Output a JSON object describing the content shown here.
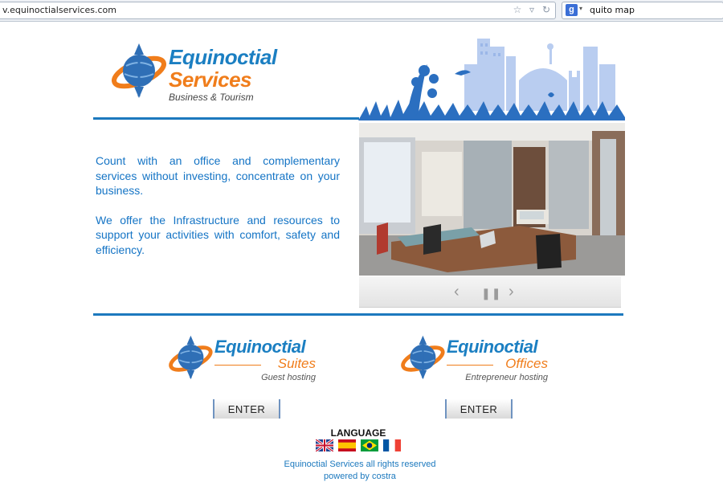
{
  "browser": {
    "url": "v.equinoctialservices.com",
    "search_engine_icon": "google-icon",
    "search_query": "quito map"
  },
  "header": {
    "logo_line1": "Equinoctial",
    "logo_line2": "Services",
    "logo_tagline": "Business & Tourism"
  },
  "intro": {
    "paragraph1": "Count with an office and complementary services without investing, concentrate on your business.",
    "paragraph2": "We offer the Infrastructure and resources to support your activities with comfort, safety and efficiency."
  },
  "slider": {
    "prev_icon": "chevron-left-icon",
    "pause_icon": "pause-icon",
    "next_icon": "chevron-right-icon"
  },
  "brands": [
    {
      "title": "Equinoctial",
      "subtitle": "Suites",
      "tagline": "Guest hosting",
      "button_label": "ENTER"
    },
    {
      "title": "Equinoctial",
      "subtitle": "Offices",
      "tagline": "Entrepreneur hosting",
      "button_label": "ENTER"
    }
  ],
  "language": {
    "title": "LANGUAGE",
    "flags": [
      "flag-uk-icon",
      "flag-spain-icon",
      "flag-brazil-icon",
      "flag-france-icon"
    ]
  },
  "footer": {
    "rights": "Equinoctial Services all rights reserved",
    "powered": "powered by costra"
  },
  "colors": {
    "accent_blue": "#1c79be",
    "accent_orange": "#f07d1b",
    "text_blue": "#1474c5"
  }
}
